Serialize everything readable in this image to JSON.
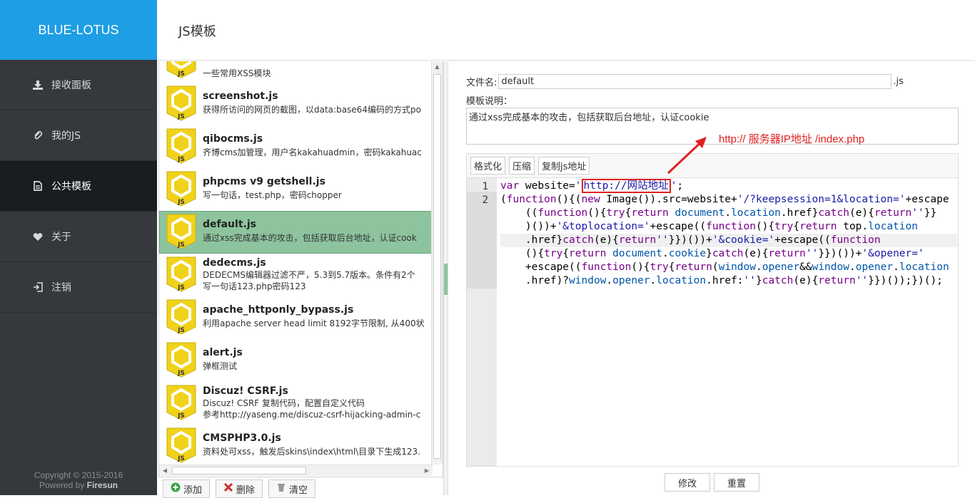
{
  "app": {
    "brand": "BLUE-LOTUS",
    "page_title": "JS模板"
  },
  "sidebar": {
    "items": [
      {
        "label": "接收面板",
        "icon": "download-tray-icon"
      },
      {
        "label": "我的JS",
        "icon": "paperclip-icon"
      },
      {
        "label": "公共模板",
        "icon": "document-icon",
        "active": true
      },
      {
        "label": "关于",
        "icon": "heart-icon"
      },
      {
        "label": "注销",
        "icon": "logout-icon"
      }
    ],
    "copyright_line1": "Copyright © 2015-2016",
    "copyright_prefix": "Powered by ",
    "copyright_author": "Firesun"
  },
  "templates": [
    {
      "name": "",
      "desc": "一些常用XSS模块"
    },
    {
      "name": "screenshot.js",
      "desc": "获得所访问的网页的截图，以data:base64编码的方式po"
    },
    {
      "name": "qibocms.js",
      "desc": "齐博cms加管理，用户名kakahuadmin，密码kakahuac"
    },
    {
      "name": "phpcms v9 getshell.js",
      "desc": "写一句话，test.php，密码chopper"
    },
    {
      "name": "default.js",
      "desc": "通过xss完成基本的攻击，包括获取后台地址，认证cook",
      "selected": true
    },
    {
      "name": "dedecms.js",
      "desc": "DEDECMS编辑器过滤不严，5.3到5.7版本。条件有2个",
      "desc2": "写一句话123.php密码123"
    },
    {
      "name": "apache_httponly_bypass.js",
      "desc": "利用apache server head limit 8192字节限制, 从400状"
    },
    {
      "name": "alert.js",
      "desc": "弹框测试"
    },
    {
      "name": "Discuz!  CSRF.js",
      "desc": "Discuz!  CSRF  复制代码，配置自定义代码",
      "desc2": "参考http://yaseng.me/discuz-csrf-hijacking-admin-c"
    },
    {
      "name": "CMSPHP3.0.js",
      "desc": "资料处可xss，触发后skins\\index\\html\\目录下生成123."
    }
  ],
  "list_actions": {
    "add": "添加",
    "delete": "删除",
    "clear": "清空"
  },
  "editor": {
    "filename_label": "文件名:",
    "filename_value": "default",
    "filename_ext": ".js",
    "desc_label": "模板说明：",
    "desc_value": "通过xss完成基本的攻击，包括获取后台地址，认证cookie",
    "toolbar": {
      "format": "格式化",
      "compress": "压缩",
      "copy_url": "复制js地址"
    },
    "line_numbers": [
      "1",
      "2"
    ],
    "url_placeholder": "http://网站地址",
    "annotation": "http://  服务器IP地址 /index.php",
    "save": "修改",
    "reset": "重置"
  },
  "colors": {
    "brand": "#1e9ee5",
    "sidebar": "#35393c",
    "selected_row": "#8dc49e",
    "annotation": "#e02020"
  }
}
